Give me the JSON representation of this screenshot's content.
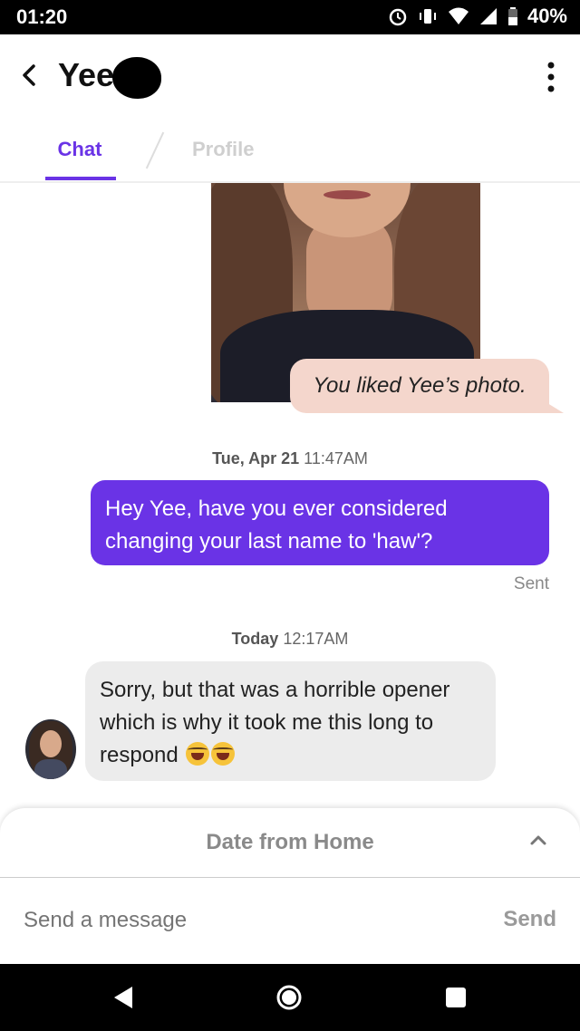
{
  "status_bar": {
    "time": "01:20",
    "battery": "40%"
  },
  "header": {
    "title": "Yee"
  },
  "tabs": [
    {
      "label": "Chat"
    },
    {
      "label": "Profile"
    }
  ],
  "chat": {
    "liked_notice": "You liked Yee’s photo.",
    "timestamp1": {
      "day": "Tue, Apr 21",
      "time": "11:47AM"
    },
    "sent_message": "Hey Yee, have you ever considered changing your last name to 'haw'?",
    "sent_status": "Sent",
    "timestamp2": {
      "day": "Today",
      "time": "12:17AM"
    },
    "received_message": "Sorry, but that was a horrible opener which is why it took me this long to respond"
  },
  "date_panel": {
    "label": "Date from Home"
  },
  "composer": {
    "placeholder": "Send a message",
    "send_label": "Send"
  },
  "colors": {
    "accent": "#6a33e6",
    "liked_bubble": "#f4d6cc",
    "received_bubble": "#ececec"
  }
}
